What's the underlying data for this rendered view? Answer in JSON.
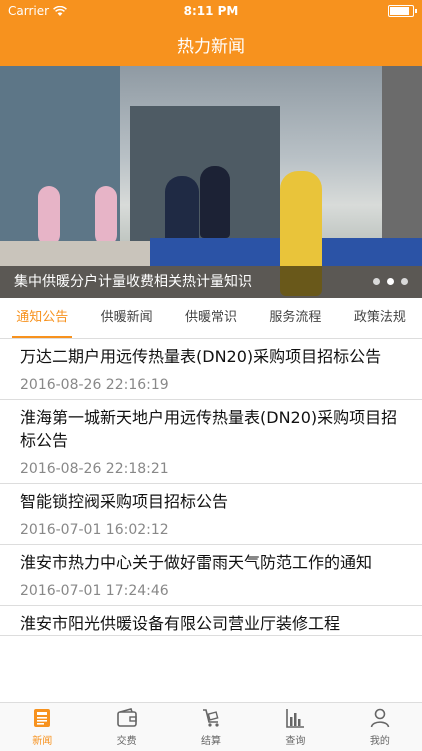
{
  "status_bar": {
    "carrier": "Carrier",
    "time": "8:11 PM",
    "battery_level": 0.95
  },
  "nav": {
    "title": "热力新闻"
  },
  "banner": {
    "caption": "集中供暖分户计量收费相关热计量知识",
    "page_count": 3,
    "active_page": 2
  },
  "tabs": [
    {
      "label": "通知公告",
      "active": true
    },
    {
      "label": "供暖新闻",
      "active": false
    },
    {
      "label": "供暖常识",
      "active": false
    },
    {
      "label": "服务流程",
      "active": false
    },
    {
      "label": "政策法规",
      "active": false
    }
  ],
  "news": [
    {
      "title": "万达二期户用远传热量表(DN20)采购项目招标公告",
      "date": "2016-08-26 22:16:19"
    },
    {
      "title": "淮海第一城新天地户用远传热量表(DN20)采购项目招标公告",
      "date": "2016-08-26 22:18:21"
    },
    {
      "title": "智能锁控阀采购项目招标公告",
      "date": "2016-07-01 16:02:12"
    },
    {
      "title": "淮安市热力中心关于做好雷雨天气防范工作的通知",
      "date": "2016-07-01 17:24:46"
    },
    {
      "title": "淮安市阳光供暖设备有限公司营业厅装修工程",
      "date": ""
    }
  ],
  "tabbar": [
    {
      "label": "新闻",
      "icon": "news-icon",
      "active": true
    },
    {
      "label": "交费",
      "icon": "wallet-icon",
      "active": false
    },
    {
      "label": "结算",
      "icon": "cart-icon",
      "active": false
    },
    {
      "label": "查询",
      "icon": "bar-chart-icon",
      "active": false
    },
    {
      "label": "我的",
      "icon": "person-icon",
      "active": false
    }
  ],
  "colors": {
    "accent": "#f7921e"
  }
}
